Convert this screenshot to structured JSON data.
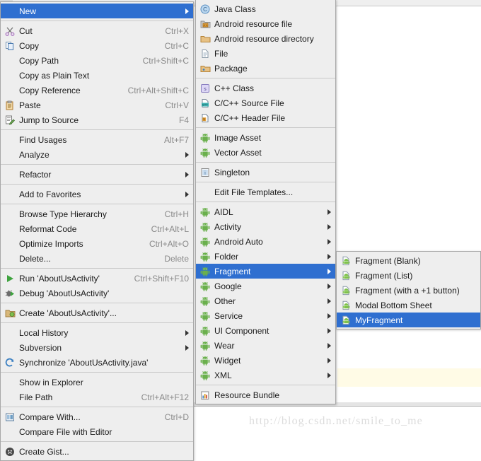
{
  "watermark": "http://blog.csdn.net/smile_to_me",
  "colors": {
    "selection": "#2f6fd0",
    "menu_bg": "#eeeeee",
    "menu_border": "#a8a8a8",
    "accel_text": "#8a8a8a",
    "highlight_band": "#fffbe6"
  },
  "context_menu": {
    "name": "editor-context-menu",
    "groups": [
      {
        "items": [
          {
            "label": "New",
            "accel": "",
            "icon": "none",
            "submenu": true,
            "selected": true
          }
        ]
      },
      {
        "items": [
          {
            "label": "Cut",
            "accel": "Ctrl+X",
            "icon": "scissors-icon",
            "submenu": false,
            "selected": false
          },
          {
            "label": "Copy",
            "accel": "Ctrl+C",
            "icon": "copy-icon",
            "submenu": false,
            "selected": false
          },
          {
            "label": "Copy Path",
            "accel": "Ctrl+Shift+C",
            "icon": "none",
            "submenu": false,
            "selected": false
          },
          {
            "label": "Copy as Plain Text",
            "accel": "",
            "icon": "none",
            "submenu": false,
            "selected": false
          },
          {
            "label": "Copy Reference",
            "accel": "Ctrl+Alt+Shift+C",
            "icon": "none",
            "submenu": false,
            "selected": false
          },
          {
            "label": "Paste",
            "accel": "Ctrl+V",
            "icon": "paste-icon",
            "submenu": false,
            "selected": false
          },
          {
            "label": "Jump to Source",
            "accel": "F4",
            "icon": "jump-to-source-icon",
            "submenu": false,
            "selected": false
          }
        ]
      },
      {
        "items": [
          {
            "label": "Find Usages",
            "accel": "Alt+F7",
            "icon": "none",
            "submenu": false,
            "selected": false
          },
          {
            "label": "Analyze",
            "accel": "",
            "icon": "none",
            "submenu": true,
            "selected": false
          }
        ]
      },
      {
        "items": [
          {
            "label": "Refactor",
            "accel": "",
            "icon": "none",
            "submenu": true,
            "selected": false
          }
        ]
      },
      {
        "items": [
          {
            "label": "Add to Favorites",
            "accel": "",
            "icon": "none",
            "submenu": true,
            "selected": false
          }
        ]
      },
      {
        "items": [
          {
            "label": "Browse Type Hierarchy",
            "accel": "Ctrl+H",
            "icon": "none",
            "submenu": false,
            "selected": false
          },
          {
            "label": "Reformat Code",
            "accel": "Ctrl+Alt+L",
            "icon": "none",
            "submenu": false,
            "selected": false
          },
          {
            "label": "Optimize Imports",
            "accel": "Ctrl+Alt+O",
            "icon": "none",
            "submenu": false,
            "selected": false
          },
          {
            "label": "Delete...",
            "accel": "Delete",
            "icon": "none",
            "submenu": false,
            "selected": false
          }
        ]
      },
      {
        "items": [
          {
            "label": "Run 'AboutUsActivity'",
            "accel": "Ctrl+Shift+F10",
            "icon": "run-icon",
            "submenu": false,
            "selected": false
          },
          {
            "label": "Debug 'AboutUsActivity'",
            "accel": "",
            "icon": "debug-icon",
            "submenu": false,
            "selected": false
          }
        ]
      },
      {
        "items": [
          {
            "label": "Create 'AboutUsActivity'...",
            "accel": "",
            "icon": "create-config-icon",
            "submenu": false,
            "selected": false
          }
        ]
      },
      {
        "items": [
          {
            "label": "Local History",
            "accel": "",
            "icon": "none",
            "submenu": true,
            "selected": false
          },
          {
            "label": "Subversion",
            "accel": "",
            "icon": "none",
            "submenu": true,
            "selected": false
          },
          {
            "label": "Synchronize 'AboutUsActivity.java'",
            "accel": "",
            "icon": "sync-icon",
            "submenu": false,
            "selected": false
          }
        ]
      },
      {
        "items": [
          {
            "label": "Show in Explorer",
            "accel": "",
            "icon": "none",
            "submenu": false,
            "selected": false
          },
          {
            "label": "File Path",
            "accel": "Ctrl+Alt+F12",
            "icon": "none",
            "submenu": false,
            "selected": false
          }
        ]
      },
      {
        "items": [
          {
            "label": "Compare With...",
            "accel": "Ctrl+D",
            "icon": "compare-icon",
            "submenu": false,
            "selected": false
          },
          {
            "label": "Compare File with Editor",
            "accel": "",
            "icon": "none",
            "submenu": false,
            "selected": false
          }
        ]
      },
      {
        "items": [
          {
            "label": "Create Gist...",
            "accel": "",
            "icon": "gist-icon",
            "submenu": false,
            "selected": false
          }
        ]
      }
    ]
  },
  "new_menu": {
    "name": "new-submenu",
    "groups": [
      {
        "items": [
          {
            "label": "Java Class",
            "icon": "java-class-icon",
            "submenu": false,
            "selected": false
          },
          {
            "label": "Android resource file",
            "icon": "android-resource-file-icon",
            "submenu": false,
            "selected": false
          },
          {
            "label": "Android resource directory",
            "icon": "folder-icon",
            "submenu": false,
            "selected": false
          },
          {
            "label": "File",
            "icon": "file-icon",
            "submenu": false,
            "selected": false
          },
          {
            "label": "Package",
            "icon": "package-icon",
            "submenu": false,
            "selected": false
          }
        ]
      },
      {
        "items": [
          {
            "label": "C++ Class",
            "icon": "cpp-class-icon",
            "submenu": false,
            "selected": false
          },
          {
            "label": "C/C++ Source File",
            "icon": "cpp-source-icon",
            "submenu": false,
            "selected": false
          },
          {
            "label": "C/C++ Header File",
            "icon": "cpp-header-icon",
            "submenu": false,
            "selected": false
          }
        ]
      },
      {
        "items": [
          {
            "label": "Image Asset",
            "icon": "android-icon",
            "submenu": false,
            "selected": false
          },
          {
            "label": "Vector Asset",
            "icon": "android-icon",
            "submenu": false,
            "selected": false
          }
        ]
      },
      {
        "items": [
          {
            "label": "Singleton",
            "icon": "singleton-icon",
            "submenu": false,
            "selected": false
          }
        ]
      },
      {
        "items": [
          {
            "label": "Edit File Templates...",
            "icon": "none",
            "submenu": false,
            "selected": false
          }
        ]
      },
      {
        "items": [
          {
            "label": "AIDL",
            "icon": "android-icon",
            "submenu": true,
            "selected": false
          },
          {
            "label": "Activity",
            "icon": "android-icon",
            "submenu": true,
            "selected": false
          },
          {
            "label": "Android Auto",
            "icon": "android-icon",
            "submenu": true,
            "selected": false
          },
          {
            "label": "Folder",
            "icon": "android-icon",
            "submenu": true,
            "selected": false
          },
          {
            "label": "Fragment",
            "icon": "android-icon",
            "submenu": true,
            "selected": true
          },
          {
            "label": "Google",
            "icon": "android-icon",
            "submenu": true,
            "selected": false
          },
          {
            "label": "Other",
            "icon": "android-icon",
            "submenu": true,
            "selected": false
          },
          {
            "label": "Service",
            "icon": "android-icon",
            "submenu": true,
            "selected": false
          },
          {
            "label": "UI Component",
            "icon": "android-icon",
            "submenu": true,
            "selected": false
          },
          {
            "label": "Wear",
            "icon": "android-icon",
            "submenu": true,
            "selected": false
          },
          {
            "label": "Widget",
            "icon": "android-icon",
            "submenu": true,
            "selected": false
          },
          {
            "label": "XML",
            "icon": "android-icon",
            "submenu": true,
            "selected": false
          }
        ]
      },
      {
        "items": [
          {
            "label": "Resource Bundle",
            "icon": "resource-bundle-icon",
            "submenu": false,
            "selected": false
          }
        ]
      }
    ]
  },
  "fragment_menu": {
    "name": "fragment-submenu",
    "groups": [
      {
        "items": [
          {
            "label": "Fragment (Blank)",
            "icon": "fragment-template-icon",
            "submenu": false,
            "selected": false
          },
          {
            "label": "Fragment (List)",
            "icon": "fragment-template-icon",
            "submenu": false,
            "selected": false
          },
          {
            "label": "Fragment (with a +1 button)",
            "icon": "fragment-template-icon",
            "submenu": false,
            "selected": false
          },
          {
            "label": "Modal Bottom Sheet",
            "icon": "fragment-template-icon",
            "submenu": false,
            "selected": false
          },
          {
            "label": "MyFragment",
            "icon": "fragment-template-icon",
            "submenu": false,
            "selected": true
          }
        ]
      }
    ]
  }
}
